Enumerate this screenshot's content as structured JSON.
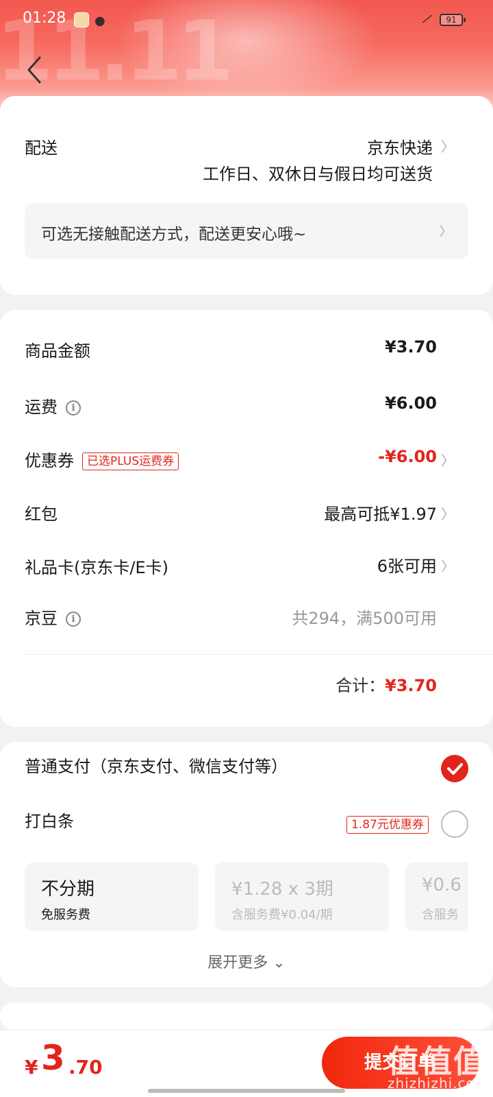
{
  "status_bar": {
    "time": "01:28",
    "battery": "91"
  },
  "header": {
    "back_label": "back",
    "decoration_text": "11.11"
  },
  "delivery": {
    "label": "配送",
    "carrier": "京东快递",
    "schedule": "工作日、双休日与假日均可送货",
    "contactless_text": "可选无接触配送方式，配送更安心哦~"
  },
  "summary": {
    "goods_amount_label": "商品金额",
    "goods_amount_value": "¥3.70",
    "shipping_label": "运费",
    "shipping_value": "¥6.00",
    "coupon_label": "优惠券",
    "coupon_tag": "已选PLUS运费券",
    "coupon_value": "-¥6.00",
    "redpacket_label": "红包",
    "redpacket_value": "最高可抵¥1.97",
    "giftcard_label": "礼品卡(京东卡/E卡)",
    "giftcard_value": "6张可用",
    "jingdou_label": "京豆",
    "jingdou_value": "共294，满500可用",
    "total_label": "合计：",
    "total_value": "¥3.70"
  },
  "payment": {
    "normal_label": "普通支付（京东支付、微信支付等）",
    "baitiao_label": "打白条",
    "baitiao_coupon": "1.87元优惠券",
    "installments": [
      {
        "title": "不分期",
        "subtitle": "免服务费"
      },
      {
        "title": "¥1.28  x  3期",
        "subtitle": "含服务费¥0.04/期"
      },
      {
        "title": "¥0.6",
        "subtitle": "含服务"
      }
    ],
    "expand_label": "展开更多 ⌄"
  },
  "footer": {
    "total_currency": "¥",
    "total_int": "3",
    "total_dec": ".70",
    "submit_label": "提交订单"
  },
  "watermark": {
    "cn": "值值值",
    "site": "zhizhizhi.com"
  },
  "colors": {
    "accent": "#e1251b",
    "header": "#f2584f"
  }
}
